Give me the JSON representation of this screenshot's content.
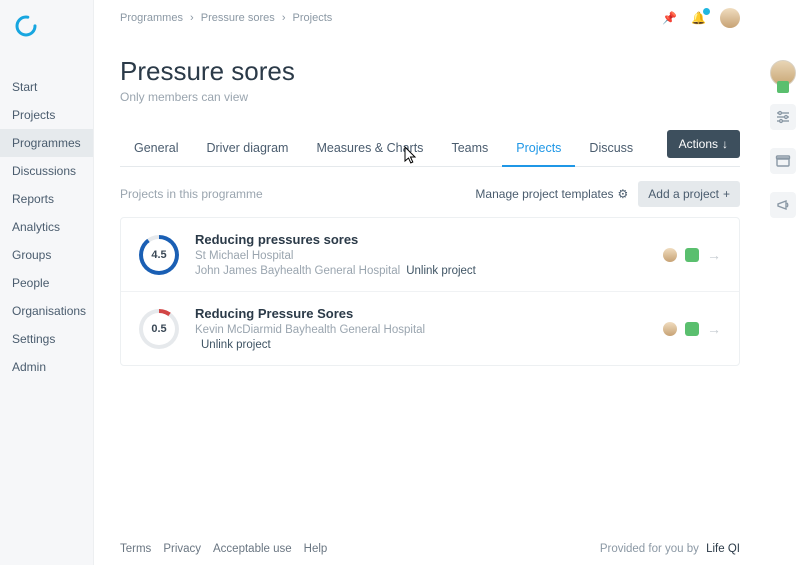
{
  "breadcrumbs": [
    "Programmes",
    "Pressure sores",
    "Projects"
  ],
  "sidebar": {
    "items": [
      {
        "label": "Start"
      },
      {
        "label": "Projects"
      },
      {
        "label": "Programmes"
      },
      {
        "label": "Discussions"
      },
      {
        "label": "Reports"
      },
      {
        "label": "Analytics"
      },
      {
        "label": "Groups"
      },
      {
        "label": "People"
      },
      {
        "label": "Organisations"
      },
      {
        "label": "Settings"
      },
      {
        "label": "Admin"
      }
    ],
    "active_index": 2
  },
  "page": {
    "title": "Pressure sores",
    "subtitle": "Only members can view"
  },
  "tabs": {
    "items": [
      "General",
      "Driver diagram",
      "Measures & Charts",
      "Teams",
      "Projects",
      "Discuss"
    ],
    "active_index": 4
  },
  "actions_button": "Actions",
  "section_label": "Projects in this programme",
  "manage_templates": "Manage project templates",
  "add_project": "Add a project",
  "projects": [
    {
      "score": "4.5",
      "ring_color": "#1a5fb4",
      "ring_fraction": 0.9,
      "title": "Reducing pressures sores",
      "line1": "St Michael Hospital",
      "line2": "John James Bayhealth General Hospital",
      "unlink": "Unlink project"
    },
    {
      "score": "0.5",
      "ring_color": "#d14545",
      "ring_fraction": 0.1,
      "title": "Reducing Pressure Sores",
      "line1": "Kevin McDiarmid Bayhealth General Hospital",
      "line2": "",
      "unlink": "Unlink project"
    }
  ],
  "footer": {
    "links": [
      "Terms",
      "Privacy",
      "Acceptable use",
      "Help"
    ],
    "tagline": "Provided for you by",
    "brand": "Life QI"
  }
}
